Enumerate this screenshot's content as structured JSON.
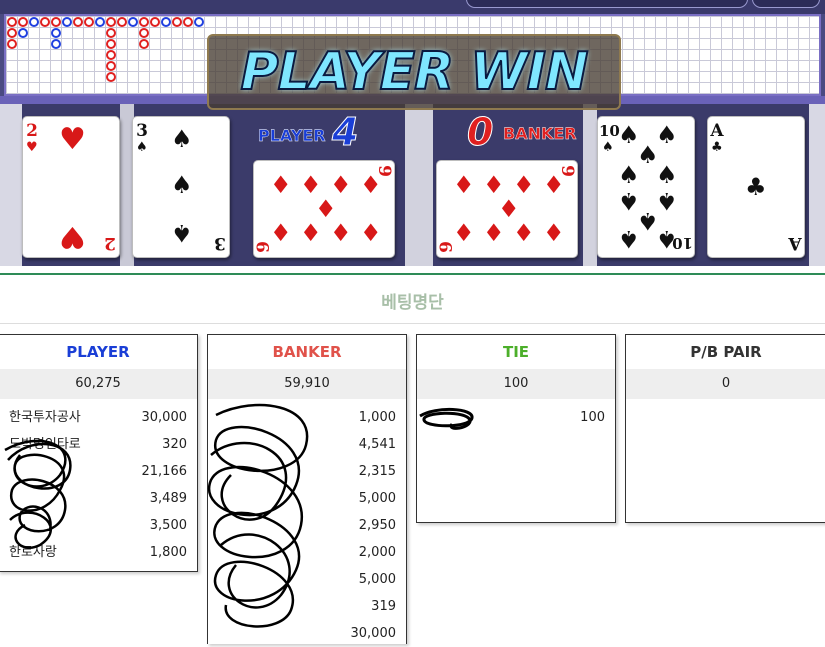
{
  "banner": {
    "result_text": "PLAYER WIN"
  },
  "scores": {
    "player_label": "PLAYER",
    "player_score": "4",
    "banker_label": "BANKER",
    "banker_score": "0"
  },
  "cards": {
    "player": [
      {
        "rank": "2",
        "suit": "♥",
        "color": "#d81818"
      },
      {
        "rank": "3",
        "suit": "♠",
        "color": "#111111"
      },
      {
        "rank": "9",
        "suit": "♦",
        "color": "#d81818",
        "rotated": true
      }
    ],
    "banker": [
      {
        "rank": "9",
        "suit": "♦",
        "color": "#d81818",
        "rotated": true
      },
      {
        "rank": "10",
        "suit": "♠",
        "color": "#111111"
      },
      {
        "rank": "A",
        "suit": "♣",
        "color": "#111111"
      }
    ]
  },
  "bet_list": {
    "title": "베팅명단",
    "panels": [
      {
        "header": "PLAYER",
        "header_color": "#1a3ed6",
        "total": "60,275",
        "rows": [
          {
            "name": "한국투자공사",
            "amount": "30,000"
          },
          {
            "name": "도박명인타로",
            "amount": "320"
          },
          {
            "name": "",
            "amount": "21,166"
          },
          {
            "name": "",
            "amount": "3,489"
          },
          {
            "name": "",
            "amount": "3,500"
          },
          {
            "name": "한로사랑",
            "amount": "1,800"
          }
        ]
      },
      {
        "header": "BANKER",
        "header_color": "#e0524a",
        "total": "59,910",
        "rows": [
          {
            "name": "",
            "amount": "1,000"
          },
          {
            "name": "",
            "amount": "4,541"
          },
          {
            "name": "",
            "amount": "2,315"
          },
          {
            "name": "",
            "amount": "5,000"
          },
          {
            "name": "",
            "amount": "2,950"
          },
          {
            "name": "",
            "amount": "2,000"
          },
          {
            "name": "",
            "amount": "5,000"
          },
          {
            "name": "",
            "amount": "319"
          },
          {
            "name": "",
            "amount": "30,000"
          }
        ]
      },
      {
        "header": "TIE",
        "header_color": "#4caf2a",
        "total": "100",
        "rows": [
          {
            "name": "",
            "amount": "100"
          }
        ]
      },
      {
        "header": "P/B PAIR",
        "header_color": "#333333",
        "total": "0",
        "rows": []
      }
    ]
  },
  "colors": {
    "game_bg": "#4a4a82",
    "accent_green": "#2e8b57",
    "player_blue": "#1a3ed6",
    "banker_red": "#e0524a",
    "tie_green": "#4caf2a"
  }
}
